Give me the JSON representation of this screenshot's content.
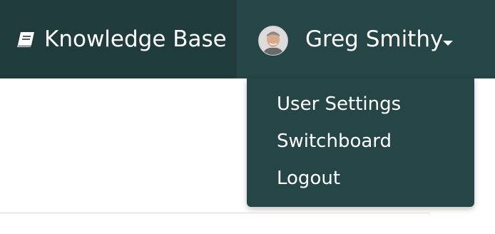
{
  "navbar": {
    "knowledge_base_label": "Knowledge Base",
    "knowledge_base_icon": "book-icon",
    "user": {
      "name": "Greg Smithy",
      "avatar_icon": "user-avatar-photo",
      "caret_icon": "caret-down-icon"
    }
  },
  "user_menu": {
    "items": [
      {
        "label": "User Settings"
      },
      {
        "label": "Switchboard"
      },
      {
        "label": "Logout"
      }
    ]
  },
  "colors": {
    "navbar_bg": "#1f3b3c",
    "user_tab_bg": "#264547",
    "dropdown_bg": "#264547",
    "text": "#ffffff"
  }
}
